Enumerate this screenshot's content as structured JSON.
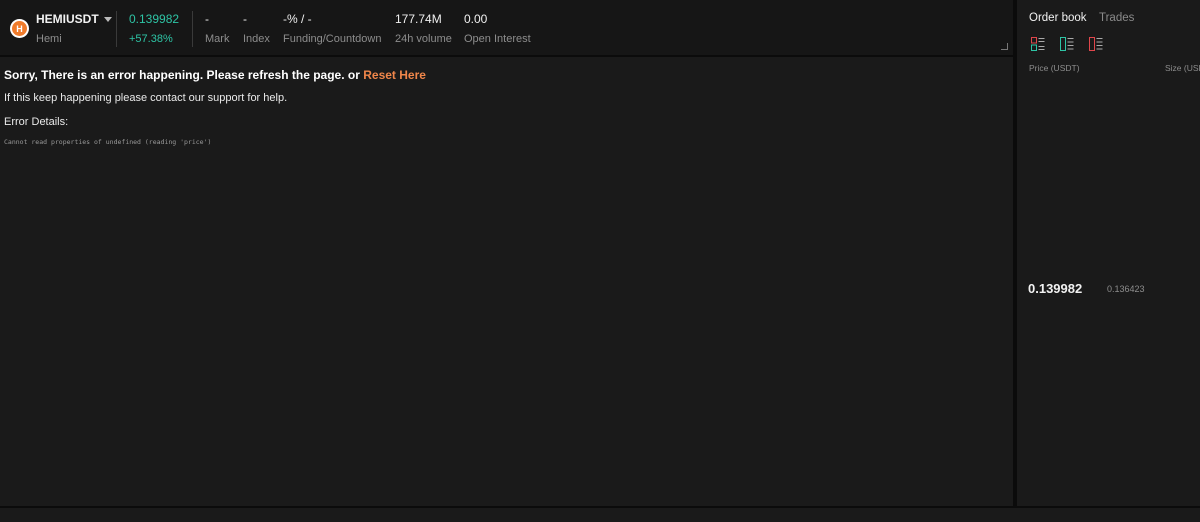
{
  "ticker": {
    "symbol": "HEMIUSDT",
    "name": "Hemi",
    "last_price": "0.139982",
    "change_pct": "+57.38%",
    "mark": {
      "value": "-",
      "label": "Mark"
    },
    "index": {
      "value": "-",
      "label": "Index"
    },
    "funding": {
      "value": "-% / -",
      "label": "Funding/Countdown"
    },
    "volume": {
      "value": "177.74M",
      "label": "24h volume"
    },
    "open_interest": {
      "value": "0.00",
      "label": "Open Interest"
    }
  },
  "error": {
    "title": "Sorry, There is an error happening. Please refresh the page. or ",
    "reset_link": "Reset Here",
    "help": "If this keep happening please contact our support for help.",
    "details_label": "Error Details:",
    "message": "Cannot read properties of undefined (reading 'price')"
  },
  "orderbook": {
    "tab_orderbook": "Order book",
    "tab_trades": "Trades",
    "col_price": "Price (USDT)",
    "col_size": "Size (USDT)",
    "last_price": "0.139982",
    "mark_price": "0.136423"
  },
  "colors": {
    "positive": "#2ec4a5",
    "negative": "#e0464b",
    "accent": "#f0864a"
  }
}
